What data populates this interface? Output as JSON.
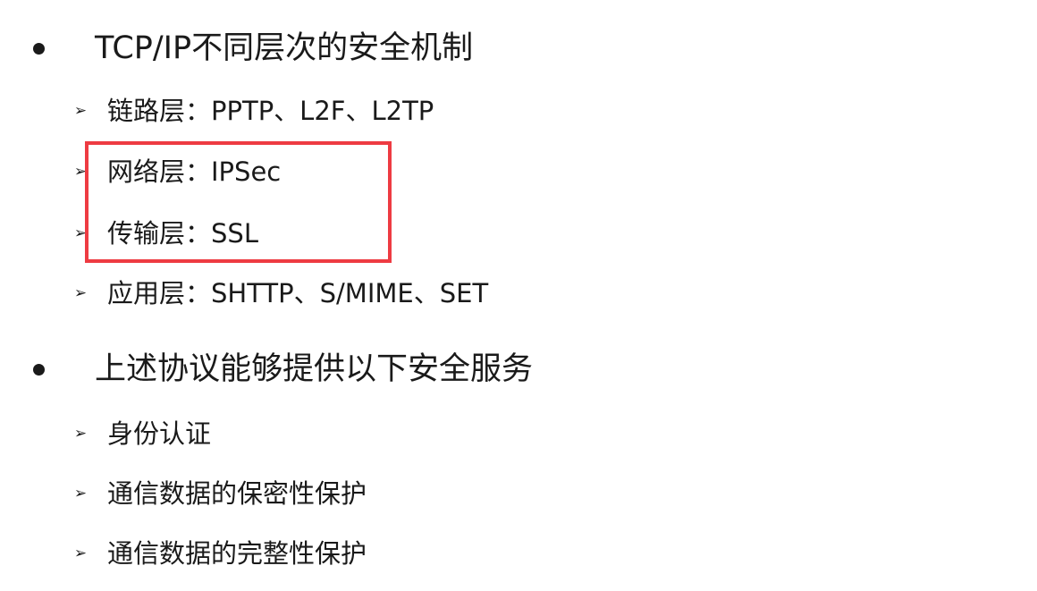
{
  "sections": [
    {
      "title": "TCP/IP不同层次的安全机制",
      "items": [
        "链路层：PPTP、L2F、L2TP",
        "网络层：IPSec",
        "传输层：SSL",
        "应用层：SHTTP、S/MIME、SET"
      ]
    },
    {
      "title": "上述协议能够提供以下安全服务",
      "items": [
        "身份认证",
        "通信数据的保密性保护",
        "通信数据的完整性保护"
      ]
    }
  ],
  "glyphs": {
    "bullet": "●",
    "arrow": "➢"
  },
  "colors": {
    "highlight_border": "#ee3b42",
    "text": "#1a1a1a"
  }
}
